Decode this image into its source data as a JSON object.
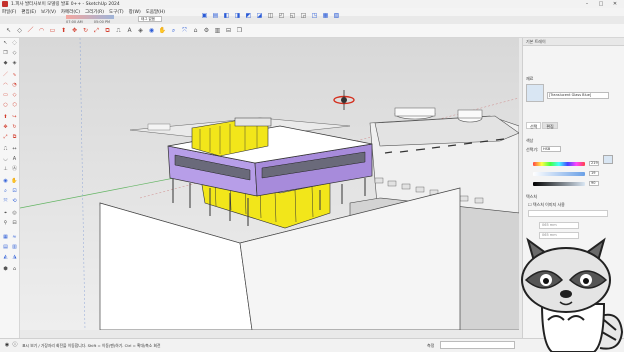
{
  "window": {
    "title": "1.피사 발터사보이 모델링 발표 0++ - SketchUp 2024",
    "controls": {
      "minimize": "–",
      "maximize": "□",
      "close": "✕"
    }
  },
  "menubar": {
    "items": [
      "파일(F)",
      "편집(E)",
      "보기(V)",
      "카메라(C)",
      "그리기(R)",
      "도구(T)",
      "창(W)",
      "도움말(H)"
    ]
  },
  "shadow": {
    "time_start": "07:00 AM",
    "time_end": "05:00 PM",
    "layer_value": "태그 없음",
    "style_value": "그림자 표시"
  },
  "right_panel": {
    "title": "기본 트레이",
    "section": "재료",
    "material_name": "[Translucent Glass Blue]",
    "tabs": [
      "선택",
      "편집"
    ],
    "color_label": "색상",
    "picker_label": "선택기:",
    "picker_value": "HSB",
    "h_value": "219",
    "s_value": "19",
    "b_value": "90",
    "texture_label": "텍스처",
    "texture_checkbox": "텍스처 이미지 사용",
    "texture_path_placeholder": "",
    "width_placeholder": "065 mm",
    "height_placeholder": "065 mm"
  },
  "statusbar": {
    "status_text": "표시 보기 / 가장자리 회전을 이동합니다. Shift = 이동(팬)하기. Ctrl = 확대/축소 회전",
    "measure_label": "측정",
    "measure_value": ""
  },
  "colors": {
    "accent_purple": "#b79ee8",
    "glass_yellow": "#f2e61a",
    "hue_bar": "#d9e6f3",
    "ground": "#d3d3d3",
    "sky_top": "#d8d8d8"
  }
}
